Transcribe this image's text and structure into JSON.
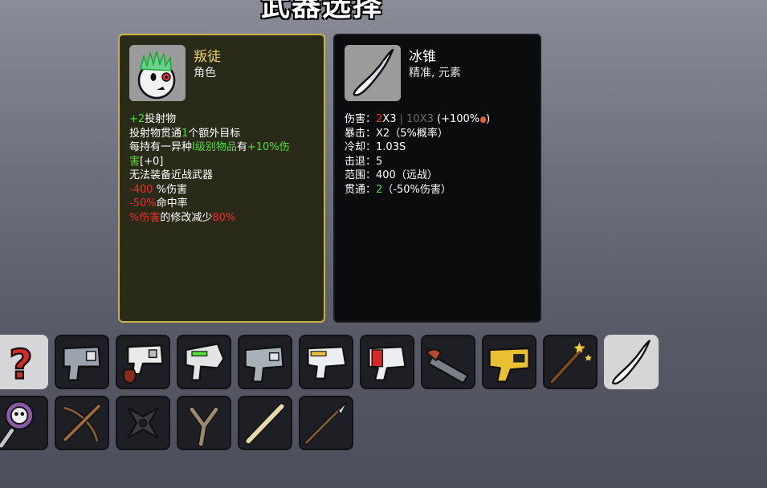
{
  "screen_title": "武器选择",
  "character": {
    "name": "叛徒",
    "type": "角色",
    "description": [
      [
        {
          "t": "+2",
          "c": "green"
        },
        {
          "t": "投射物",
          "c": ""
        }
      ],
      [
        {
          "t": "投射物贯通",
          "c": ""
        },
        {
          "t": "1",
          "c": "green"
        },
        {
          "t": "个额外目标",
          "c": ""
        }
      ],
      [
        {
          "t": "每持有一异种",
          "c": ""
        },
        {
          "t": "I级别物品",
          "c": "green"
        },
        {
          "t": "有",
          "c": ""
        },
        {
          "t": "+10%伤",
          "c": "green"
        }
      ],
      [
        {
          "t": "害",
          "c": "green"
        },
        {
          "t": "[+0]",
          "c": ""
        }
      ],
      [
        {
          "t": "无法装备近战武器",
          "c": ""
        }
      ],
      [
        {
          "t": "-400",
          "c": "red"
        },
        {
          "t": " %伤害",
          "c": ""
        }
      ],
      [
        {
          "t": "-50%",
          "c": "red"
        },
        {
          "t": "命中率",
          "c": ""
        }
      ],
      [
        {
          "t": "%伤害",
          "c": "red"
        },
        {
          "t": "的修改减少",
          "c": ""
        },
        {
          "t": "80%",
          "c": "red"
        }
      ]
    ]
  },
  "weapon": {
    "name": "冰锥",
    "tags": "精准, 元素",
    "stats": [
      [
        {
          "t": "伤害：",
          "c": ""
        },
        {
          "t": "2",
          "c": "red"
        },
        {
          "t": "X3",
          "c": ""
        },
        {
          "t": " | 10X3",
          "c": "gray"
        },
        {
          "t": " (+100%",
          "c": ""
        },
        {
          "t": "",
          "c": "drop"
        },
        {
          "t": ")",
          "c": ""
        }
      ],
      [
        {
          "t": "暴击：",
          "c": ""
        },
        {
          "t": "X2（5%概率）",
          "c": ""
        }
      ],
      [
        {
          "t": "冷却：",
          "c": ""
        },
        {
          "t": "1.03S",
          "c": ""
        }
      ],
      [
        {
          "t": "击退：",
          "c": ""
        },
        {
          "t": "5",
          "c": ""
        }
      ],
      [
        {
          "t": "范围：",
          "c": ""
        },
        {
          "t": "400（远战）",
          "c": ""
        }
      ],
      [
        {
          "t": "贯通：",
          "c": ""
        },
        {
          "t": "2",
          "c": "green"
        },
        {
          "t": "（-50%伤害）",
          "c": ""
        }
      ]
    ]
  },
  "weapon_slots": {
    "row1": [
      "random-icon",
      "pistol-icon",
      "flame-pistol-icon",
      "blaster-icon",
      "gatling-pistol-icon",
      "laser-gun-icon",
      "rocket-launcher-icon",
      "shotgun-icon",
      "taser-icon",
      "magic-wand-icon",
      "icicle-icon"
    ],
    "row2": [
      "skull-staff-icon",
      "crossbow-icon",
      "shuriken-icon",
      "slingshot-icon",
      "flute-icon",
      "spear-icon"
    ],
    "selected": "icicle-icon"
  }
}
